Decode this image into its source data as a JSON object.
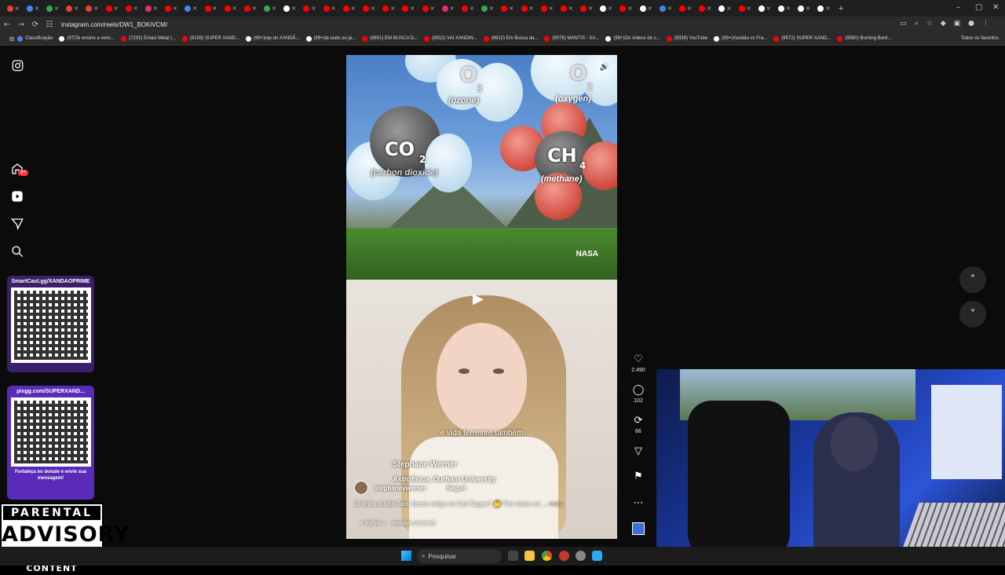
{
  "browser": {
    "url": "instagram.com/reels/DW1_BOKiVCM/",
    "tab_count": 46,
    "tab_favicon_colors": [
      "#e94235",
      "#4285f4",
      "#34a853",
      "#ea4335",
      "#e94235",
      "#ff0000",
      "#ff0000",
      "#e1306c",
      "#ff0000",
      "#4285f4",
      "#ff0000",
      "#ff0000",
      "#ff0000",
      "#34a853",
      "#ffffff",
      "#ff0000",
      "#ff0000",
      "#ff0000",
      "#ff0000",
      "#ff0000",
      "#ff0000",
      "#ff0000",
      "#e1306c",
      "#ff0000",
      "#34a853",
      "#ff0000",
      "#ff0000",
      "#ff0000",
      "#ff0000",
      "#ff0000",
      "#ffffff",
      "#ff0000",
      "#ffffff",
      "#4285f4",
      "#ff0000",
      "#ff0000",
      "#ffffff",
      "#ff0000",
      "#ffffff",
      "#ffffff",
      "#ffffff",
      "#ffffff"
    ],
    "new_tab_symbol": "+",
    "bookmarks": [
      {
        "label": "Classificação",
        "color": "#4285f4"
      },
      {
        "label": "(97)Te ensino a venc...",
        "color": "#ffffff"
      },
      {
        "label": "(7292) Enlasi Metal |...",
        "color": "#ff0000"
      },
      {
        "label": "(8159) SUPER XAND...",
        "color": "#ff0000"
      },
      {
        "label": "(99+)rap do XANDÃ...",
        "color": "#ffffff"
      },
      {
        "label": "(99+)tá cedo ou já...",
        "color": "#ffffff"
      },
      {
        "label": "(8851) EM BUSCA D...",
        "color": "#ff0000"
      },
      {
        "label": "(8912) VAI XANDIN...",
        "color": "#ff0000"
      },
      {
        "label": "(8912) Em Busca da...",
        "color": "#ff0000"
      },
      {
        "label": "(9078) MANTIS - XA...",
        "color": "#ff0000"
      },
      {
        "label": "(99+)Os vídeos de c...",
        "color": "#ffffff"
      },
      {
        "label": "(9338) YouTube",
        "color": "#ff0000"
      },
      {
        "label": "(99+)Xandão vs Fra...",
        "color": "#ffffff"
      },
      {
        "label": "(9572) SUPER XAND...",
        "color": "#ff0000"
      },
      {
        "label": "(9580) Burning Bord...",
        "color": "#ff0000"
      }
    ],
    "all_bookmarks": "Todos os favoritos"
  },
  "instagram": {
    "notification_badge": "9+"
  },
  "reel": {
    "molecules": {
      "o3_main": "O",
      "o3_sub": "3",
      "o3_name": "(ozone)",
      "o2_main": "O",
      "o2_sub": "2",
      "o2_name": "(oxygen)",
      "co2_main": "CO",
      "co2_sub": "2",
      "co2_name": "(carbon dioxide)",
      "ch4_main": "CH",
      "ch4_sub": "4",
      "ch4_name": "(methane)"
    },
    "watermark": "NASA",
    "subtitle": "e vida terrestre também",
    "speaker_name": "Stephane Werner",
    "speaker_role": "Astrofísica, Durham University",
    "author": "stephanevwerner",
    "follow_label": "Seguir",
    "description": "Já tinha ouvido falar desse artigo do Carl Sagan? 🤔 Tem tanta coi",
    "more_label": "... mais",
    "audio": "ByErik ♫ · desolate (Slowed)"
  },
  "actions": {
    "likes": "2.490",
    "comments": "102",
    "reposts": "66"
  },
  "overlays": {
    "qr1_title": "SmartCast.gg/XANDAOPRIME",
    "qr2_title": "pixgg.com/SUPERXAND...",
    "qr2_footer": "Fortaleça no donate e envie sua mensagem!",
    "advisory_top": "PARENTAL",
    "advisory_mid": "ADVISORY",
    "advisory_bot": "EXPLICIT CONTENT"
  },
  "taskbar": {
    "search_placeholder": "Pesquisar"
  }
}
